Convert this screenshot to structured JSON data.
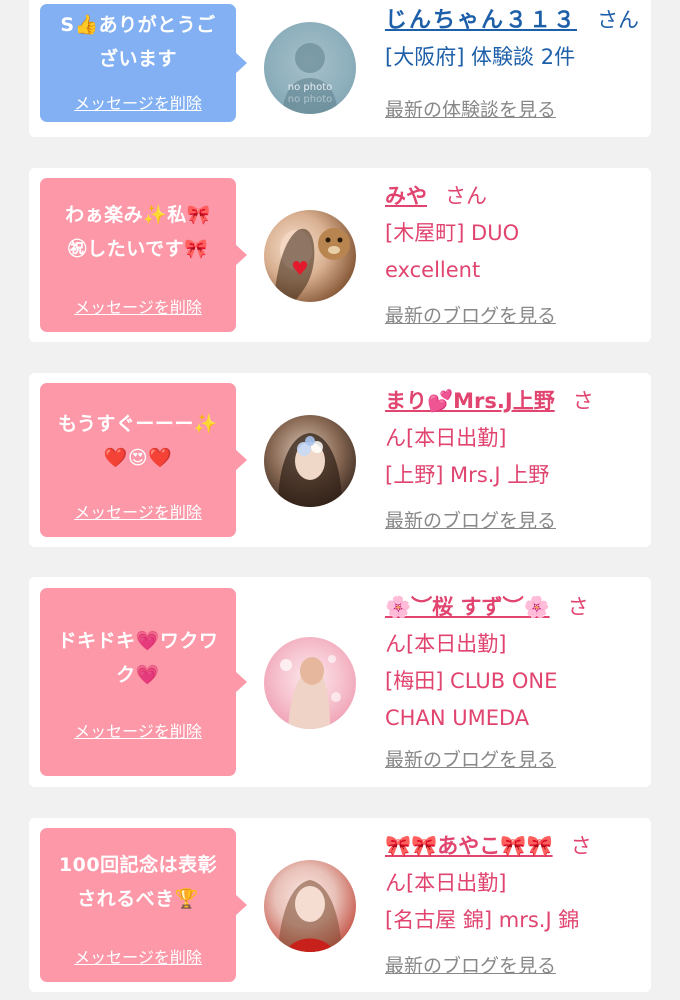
{
  "messages": [
    {
      "text_line1": "S👍ありがとうご",
      "text_line2": "ざいます",
      "delete_label": "メッセージを削除",
      "avatar_text_1": "no photo",
      "avatar_text_2": "no photo",
      "name": "じんちゃん３１３",
      "honorific": "さん",
      "meta_line1": "[大阪府] 体験談 2件",
      "meta_line2": "",
      "link_label": "最新の体験談を見る"
    },
    {
      "text_line1": "わぁ楽み✨私🎀",
      "text_line2": "㊗したいです🎀",
      "delete_label": "メッセージを削除",
      "name": "みや",
      "honorific": "さん",
      "meta_line1": "[木屋町] DUO",
      "meta_line2": "excellent",
      "link_label": "最新のブログを見る"
    },
    {
      "text_line1": "もうすぐーーー✨",
      "text_line2": "❤️😍❤️",
      "delete_label": "メッセージを削除",
      "name": "まり💕Mrs.J上野",
      "honorific": "さ",
      "status": "ん[本日出勤]",
      "meta_line1": "[上野] Mrs.J 上野",
      "meta_line2": "",
      "link_label": "最新のブログを見る"
    },
    {
      "text_line1": "ドキドキ💗ワクワ",
      "text_line2": "ク💗",
      "delete_label": "メッセージを削除",
      "name": "🌸︶桜 すず︶🌸",
      "honorific": "さ",
      "status": "ん[本日出勤]",
      "meta_line1": "[梅田] CLUB ONE",
      "meta_line2": "CHAN UMEDA",
      "link_label": "最新のブログを見る"
    },
    {
      "text_line1": "100回記念は表彰",
      "text_line2": "されるべき🏆",
      "delete_label": "メッセージを削除",
      "name": "🎀🎀あやこ🎀🎀",
      "honorific": "さ",
      "status": "ん[本日出勤]",
      "meta_line1": "[名古屋 錦] mrs.J 錦",
      "meta_line2": "",
      "link_label": "最新のブログを見る"
    }
  ],
  "colors": {
    "bubble_blue": "#82b0f2",
    "bubble_pink": "#fc98a8",
    "name_blue": "#1d5fa8",
    "name_pink": "#e0446f",
    "link_gray": "#888888",
    "background": "#f1f1f1"
  }
}
